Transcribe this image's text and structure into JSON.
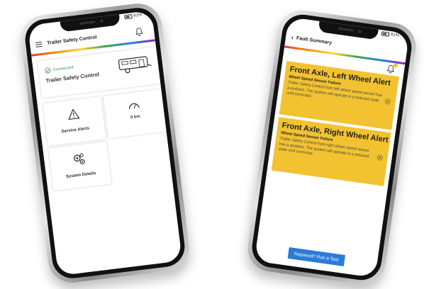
{
  "left_phone": {
    "status": {
      "battery": "81%"
    },
    "app_title": "Trailer Safety Control",
    "connection": {
      "status": "Connected",
      "device_name": "Trailer Safety Control"
    },
    "tiles": {
      "service_alerts": "Service Alerts",
      "odometer": "0 km",
      "system_details": "System Details"
    }
  },
  "right_phone": {
    "status": {
      "battery": "81%"
    },
    "back_label": "Fault Summary",
    "alerts": [
      {
        "title": "Front Axle, Left Wheel Alert",
        "subtitle": "Wheel Speed Sensor Failure",
        "description": "Trailer Safety Control front left wheel speed sensor has a problem. The system will operate in a reduced state until corrected."
      },
      {
        "title": "Front Axle, Right Wheel Alert",
        "subtitle": "Wheel Speed Sensor Failure",
        "description": "Trailer Safety Control front right wheel speed sensor has a problem. The system will operate in a reduced state until corrected."
      }
    ],
    "run_test_label": "Repaired? Run a Test"
  },
  "colors": {
    "alert_yellow": "#f2c230",
    "button_blue": "#2b7bd8",
    "connected_green": "#2e9e4f",
    "notification_dot": "#f2c230"
  },
  "icons": [
    "menu-icon",
    "bell-icon",
    "check-circle-icon",
    "trailer-icon",
    "warning-icon",
    "gauge-icon",
    "gears-icon",
    "back-chevron-icon",
    "gear-icon",
    "battery-icon"
  ]
}
